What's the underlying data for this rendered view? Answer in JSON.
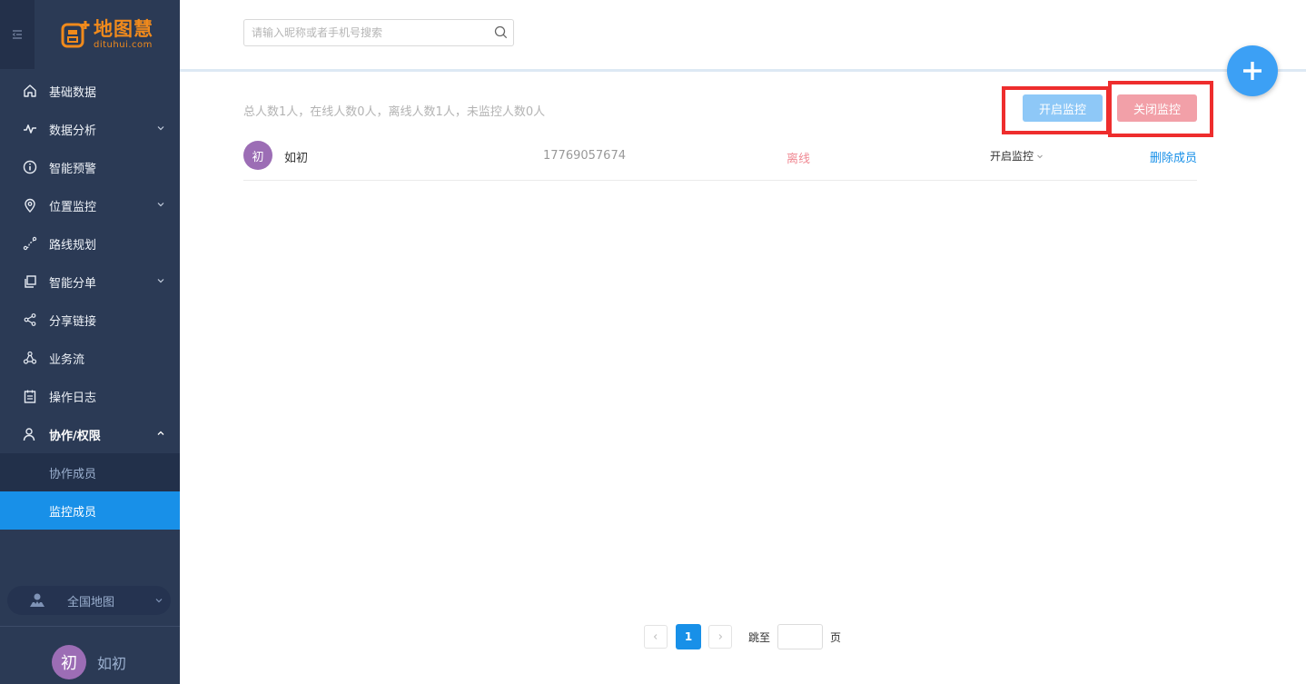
{
  "brand": {
    "name_cn": "地图慧",
    "name_en": "dituhui.com",
    "color": "#f08a1c"
  },
  "sidebar": {
    "items": [
      {
        "label": "基础数据",
        "icon": "home-icon",
        "expandable": false
      },
      {
        "label": "数据分析",
        "icon": "analytics-wave-icon",
        "expandable": true
      },
      {
        "label": "智能预警",
        "icon": "info-circle-icon",
        "expandable": false
      },
      {
        "label": "位置监控",
        "icon": "location-pin-icon",
        "expandable": true
      },
      {
        "label": "路线规划",
        "icon": "route-icon",
        "expandable": false
      },
      {
        "label": "智能分单",
        "icon": "copy-icon",
        "expandable": true
      },
      {
        "label": "分享链接",
        "icon": "share-icon",
        "expandable": false
      },
      {
        "label": "业务流",
        "icon": "workflow-icon",
        "expandable": false
      },
      {
        "label": "操作日志",
        "icon": "clipboard-icon",
        "expandable": false
      },
      {
        "label": "协作/权限",
        "icon": "user-icon",
        "expandable": true,
        "open": true
      }
    ],
    "sub_items": [
      {
        "label": "协作成员",
        "active": false
      },
      {
        "label": "监控成员",
        "active": true
      }
    ],
    "map_switch": {
      "label": "全国地图",
      "icon": "map-user-icon"
    },
    "user": {
      "avatar_char": "初",
      "name": "如初"
    }
  },
  "search": {
    "placeholder": "请输入昵称或者手机号搜索",
    "value": ""
  },
  "summary": "总人数1人，在线人数0人，离线人数1人，未监控人数0人",
  "actions": {
    "open_label": "开启监控",
    "close_label": "关闭监控"
  },
  "members": [
    {
      "avatar_char": "初",
      "name": "如初",
      "phone": "17769057674",
      "status": "离线",
      "monitor_select": "开启监控",
      "remove_label": "删除成员"
    }
  ],
  "pagination": {
    "current": "1",
    "jump_label": "跳至",
    "page_suffix": "页"
  },
  "colors": {
    "sidebar_bg": "#2b3a55",
    "active_blue": "#1890e8",
    "offline_pink": "#f08a94",
    "highlight_red": "#ee2d2d",
    "avatar_purple": "#9c6db5"
  }
}
